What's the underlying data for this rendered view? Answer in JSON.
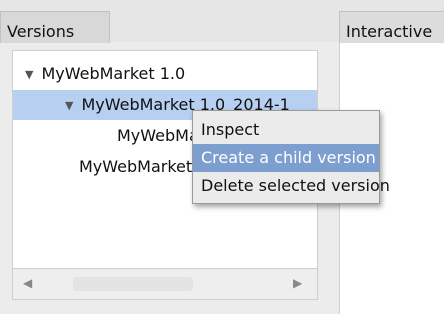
{
  "tabs": {
    "versions_label": "Versions",
    "interactive_label": "Interactive"
  },
  "tree": {
    "items": [
      {
        "label": "MyWebMarket 1.0",
        "expanded": true,
        "selected": false
      },
      {
        "label": "MyWebMarket 1.0_2014-1",
        "expanded": true,
        "selected": true
      },
      {
        "label": "MyWebMarket 1.0_2014-1.1",
        "selected": false
      },
      {
        "label": "MyWebMarket 1.1",
        "selected": false
      }
    ]
  },
  "scrollbar": {
    "left_arrow": "◀",
    "right_arrow": "▶"
  },
  "context_menu": {
    "items": [
      {
        "label": "Inspect",
        "highlighted": false
      },
      {
        "label": "Create a child version",
        "highlighted": true
      },
      {
        "label": "Delete selected version",
        "highlighted": false
      }
    ]
  },
  "colors": {
    "selection": "#b7cff0",
    "menu_highlight": "#7c9fcf"
  }
}
